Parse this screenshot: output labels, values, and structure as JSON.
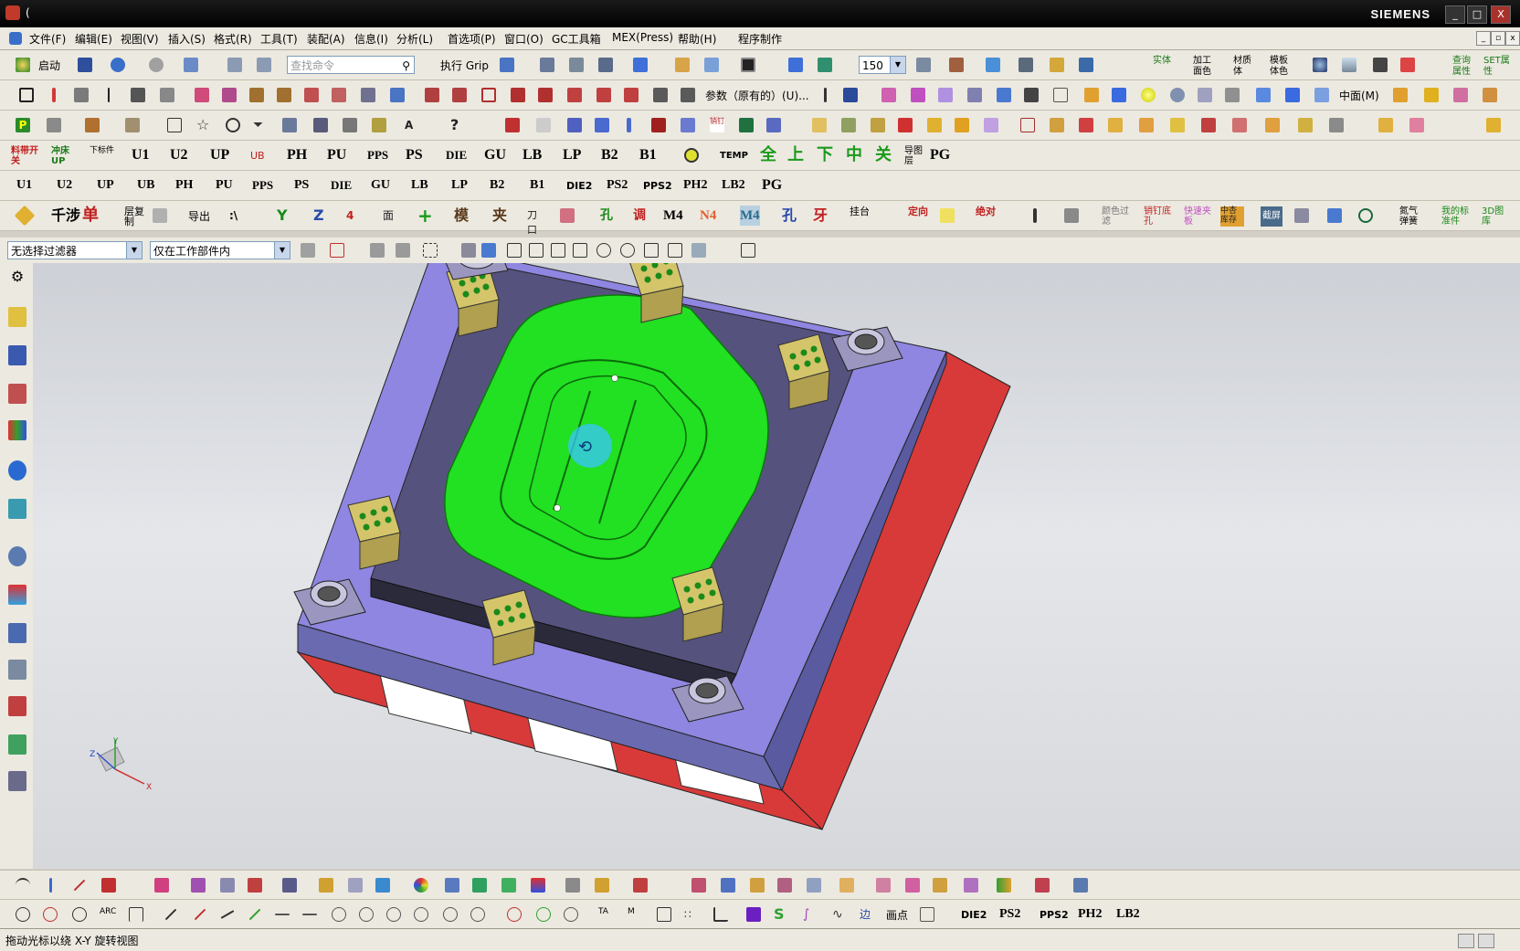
{
  "window": {
    "title": "(",
    "brand": "SIEMENS",
    "min": "_",
    "max": "□",
    "close": "X"
  },
  "menu": [
    "文件(F)",
    "编辑(E)",
    "视图(V)",
    "插入(S)",
    "格式(R)",
    "工具(T)",
    "装配(A)",
    "信息(I)",
    "分析(L)",
    "首选项(P)",
    "窗口(O)",
    "GC工具箱",
    "MEX(Press)",
    "帮助(H)",
    "程序制作"
  ],
  "toolbar1": {
    "start": "启动",
    "search_placeholder": "查找命令",
    "grip": "执行 Grip",
    "zoom_value": "150",
    "labels": [
      "实体",
      "加工面色",
      "材质体",
      "模板体色",
      "查询属性",
      "SET属性"
    ]
  },
  "toolbar2": {
    "param_label": "参数（原有的）(U)...",
    "mid_label": "中面(M)"
  },
  "toolbar4": [
    "料带开关",
    "冲床UP",
    "下标件",
    "U1",
    "U2",
    "UP",
    "UB",
    "PH",
    "PU",
    "PPS",
    "PS",
    "DIE",
    "GU",
    "LB",
    "LP",
    "B2",
    "B1",
    "TEMP",
    "全",
    "上",
    "下",
    "中",
    "关",
    "导图层",
    "PG"
  ],
  "toolbar5": [
    "U1",
    "U2",
    "UP",
    "UB",
    "PH",
    "PU",
    "PPS",
    "PS",
    "DIE",
    "GU",
    "LB",
    "LP",
    "B2",
    "B1",
    "DIE2",
    "PS2",
    "PPS2",
    "PH2",
    "LB2",
    "PG"
  ],
  "toolbar6": [
    "千涉",
    "单",
    "层复制",
    "导出",
    "M4",
    "N4",
    "M4",
    "孔",
    "牙",
    "挂台",
    "定向",
    "绝对",
    "颜色过滤",
    "销钉底孔",
    "快速夹板",
    "中杏库存",
    "截屏",
    "氮气弹簧",
    "我的标准件",
    "3D图库"
  ],
  "filter": {
    "selection_filter": "无选择过滤器",
    "scope": "仅在工作部件内"
  },
  "bottom2": {
    "point_label": "画点",
    "items": [
      "DIE2",
      "PS2",
      "PPS2",
      "PH2",
      "LB2"
    ]
  },
  "status": {
    "text": "拖动光标以绕 X-Y 旋转视图"
  },
  "triad": {
    "x": "X",
    "y": "Y",
    "z": "Z"
  },
  "colors": {
    "plate_purple": "#8e86e0",
    "cavity_green": "#22e022",
    "support_red": "#d83a3a",
    "guide_block": "#d4c56a",
    "viewport_bg": "#d8dade"
  }
}
